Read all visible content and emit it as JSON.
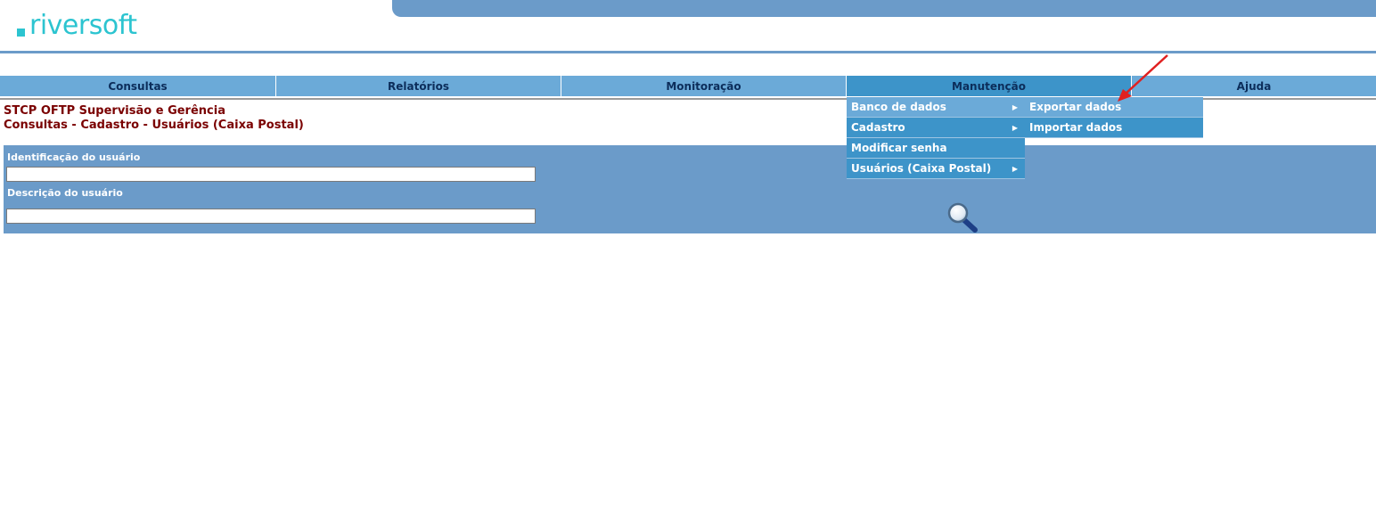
{
  "logo": {
    "text": "riversoft",
    "color": "#2cc4d0"
  },
  "nav": {
    "items": [
      {
        "label": "Consultas"
      },
      {
        "label": "Relatórios"
      },
      {
        "label": "Monitoração"
      },
      {
        "label": "Manutenção",
        "active": true
      },
      {
        "label": "Ajuda"
      }
    ]
  },
  "page": {
    "title_line1": "STCP OFTP Supervisão e Gerência",
    "title_line2": "Consultas - Cadastro - Usuários (Caixa Postal)"
  },
  "form": {
    "user_id_label": "Identificação do usuário",
    "user_id_value": "",
    "user_desc_label": "Descrição do usuário",
    "user_desc_value": "",
    "search_icon": "magnifier-icon"
  },
  "dropdown": {
    "items": [
      {
        "label": "Banco de dados",
        "has_submenu": true
      },
      {
        "label": "Cadastro",
        "has_submenu": true
      },
      {
        "label": "Modificar senha",
        "has_submenu": false
      },
      {
        "label": "Usuários (Caixa Postal)",
        "has_submenu": true
      }
    ],
    "submenu": [
      {
        "label": "Exportar dados"
      },
      {
        "label": "Importar dados"
      }
    ]
  },
  "colors": {
    "header_band": "#6b9bc9",
    "nav": "#6baad8",
    "nav_active": "#3d94c9",
    "title": "#7a0000",
    "annotation_arrow": "#e02020"
  }
}
